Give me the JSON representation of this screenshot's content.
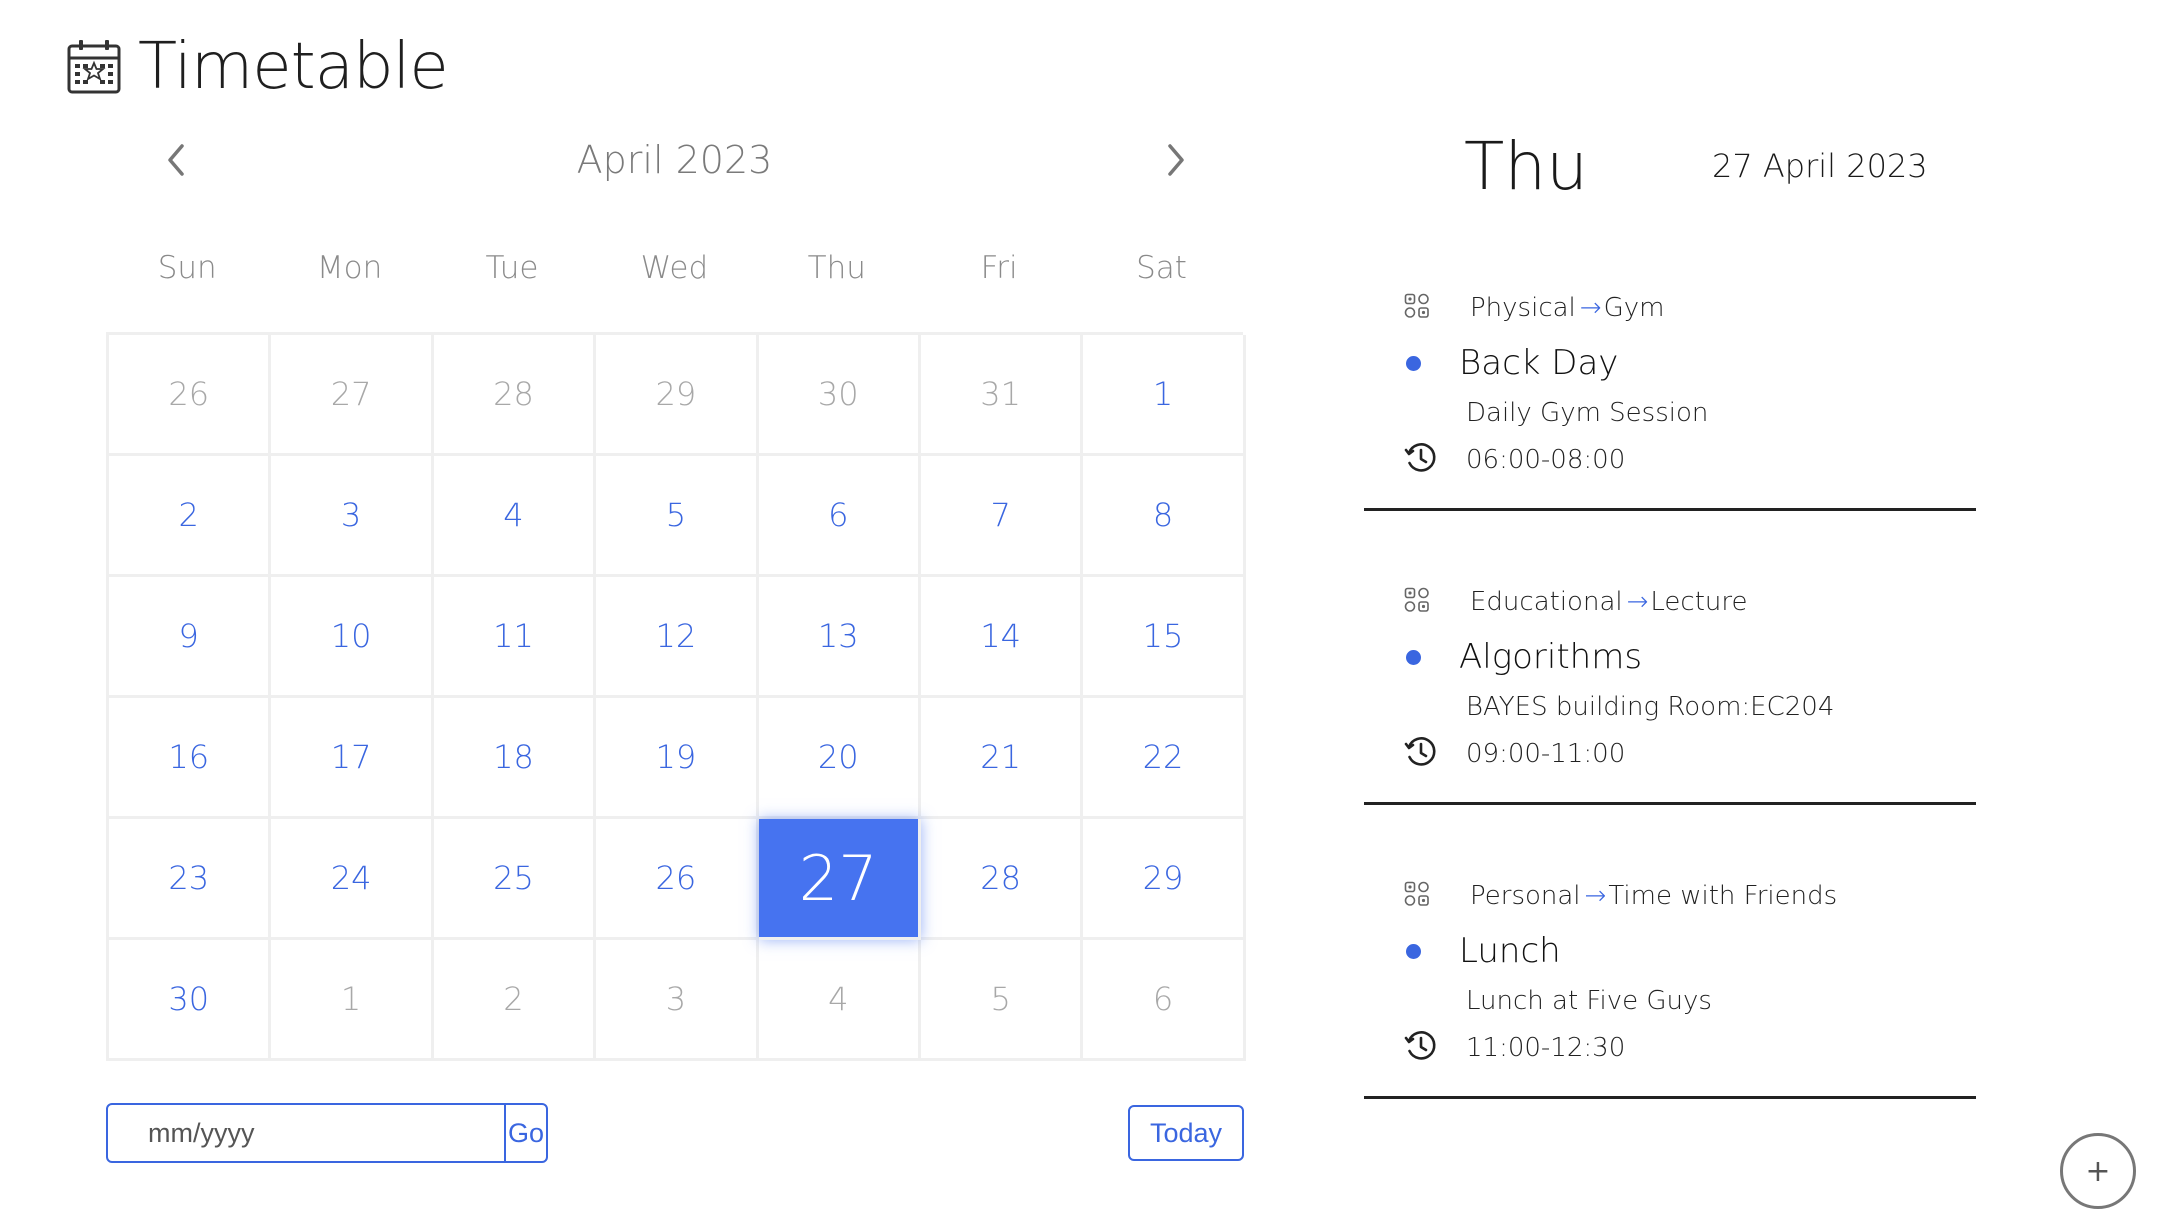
{
  "app": {
    "title": "Timetable"
  },
  "calendar": {
    "month_label": "April 2023",
    "weekdays": [
      "Sun",
      "Mon",
      "Tue",
      "Wed",
      "Thu",
      "Fri",
      "Sat"
    ],
    "days": [
      {
        "label": "26",
        "state": "other"
      },
      {
        "label": "27",
        "state": "other"
      },
      {
        "label": "28",
        "state": "other"
      },
      {
        "label": "29",
        "state": "other"
      },
      {
        "label": "30",
        "state": "other"
      },
      {
        "label": "31",
        "state": "other"
      },
      {
        "label": "1",
        "state": "cur"
      },
      {
        "label": "2",
        "state": "cur"
      },
      {
        "label": "3",
        "state": "cur"
      },
      {
        "label": "4",
        "state": "cur"
      },
      {
        "label": "5",
        "state": "cur"
      },
      {
        "label": "6",
        "state": "cur"
      },
      {
        "label": "7",
        "state": "cur"
      },
      {
        "label": "8",
        "state": "cur"
      },
      {
        "label": "9",
        "state": "cur"
      },
      {
        "label": "10",
        "state": "cur"
      },
      {
        "label": "11",
        "state": "cur"
      },
      {
        "label": "12",
        "state": "cur"
      },
      {
        "label": "13",
        "state": "cur"
      },
      {
        "label": "14",
        "state": "cur"
      },
      {
        "label": "15",
        "state": "cur"
      },
      {
        "label": "16",
        "state": "cur"
      },
      {
        "label": "17",
        "state": "cur"
      },
      {
        "label": "18",
        "state": "cur"
      },
      {
        "label": "19",
        "state": "cur"
      },
      {
        "label": "20",
        "state": "cur"
      },
      {
        "label": "21",
        "state": "cur"
      },
      {
        "label": "22",
        "state": "cur"
      },
      {
        "label": "23",
        "state": "cur"
      },
      {
        "label": "24",
        "state": "cur"
      },
      {
        "label": "25",
        "state": "cur"
      },
      {
        "label": "26",
        "state": "cur"
      },
      {
        "label": "27",
        "state": "sel"
      },
      {
        "label": "28",
        "state": "cur"
      },
      {
        "label": "29",
        "state": "cur"
      },
      {
        "label": "30",
        "state": "cur"
      },
      {
        "label": "1",
        "state": "other"
      },
      {
        "label": "2",
        "state": "other"
      },
      {
        "label": "3",
        "state": "other"
      },
      {
        "label": "4",
        "state": "other"
      },
      {
        "label": "5",
        "state": "other"
      },
      {
        "label": "6",
        "state": "other"
      }
    ],
    "goto": {
      "placeholder": "mm/yyyy",
      "value": "",
      "go_label": "Go"
    },
    "today_label": "Today"
  },
  "day_panel": {
    "day_name": "Thu",
    "date_label": "27 April 2023",
    "events": [
      {
        "category": "Physical",
        "subcategory": "Gym",
        "title": "Back Day",
        "description": "Daily Gym Session",
        "time": "06:00-08:00"
      },
      {
        "category": "Educational",
        "subcategory": "Lecture",
        "title": "Algorithms",
        "description": "BAYES building Room:EC204",
        "time": "09:00-11:00"
      },
      {
        "category": "Personal",
        "subcategory": "Time with Friends",
        "title": "Lunch",
        "description": "Lunch at Five Guys",
        "time": "11:00-12:30"
      }
    ]
  },
  "add_button": {
    "label": "+"
  },
  "icons": {
    "app": "calendar-icon",
    "prev": "chevron-left-icon",
    "next": "chevron-right-icon",
    "category": "category-grid-icon",
    "time": "clock-history-icon"
  },
  "colors": {
    "accent": "#4673f0",
    "link": "#3a66e0",
    "muted": "#a8a8a8",
    "divider": "#222222"
  }
}
